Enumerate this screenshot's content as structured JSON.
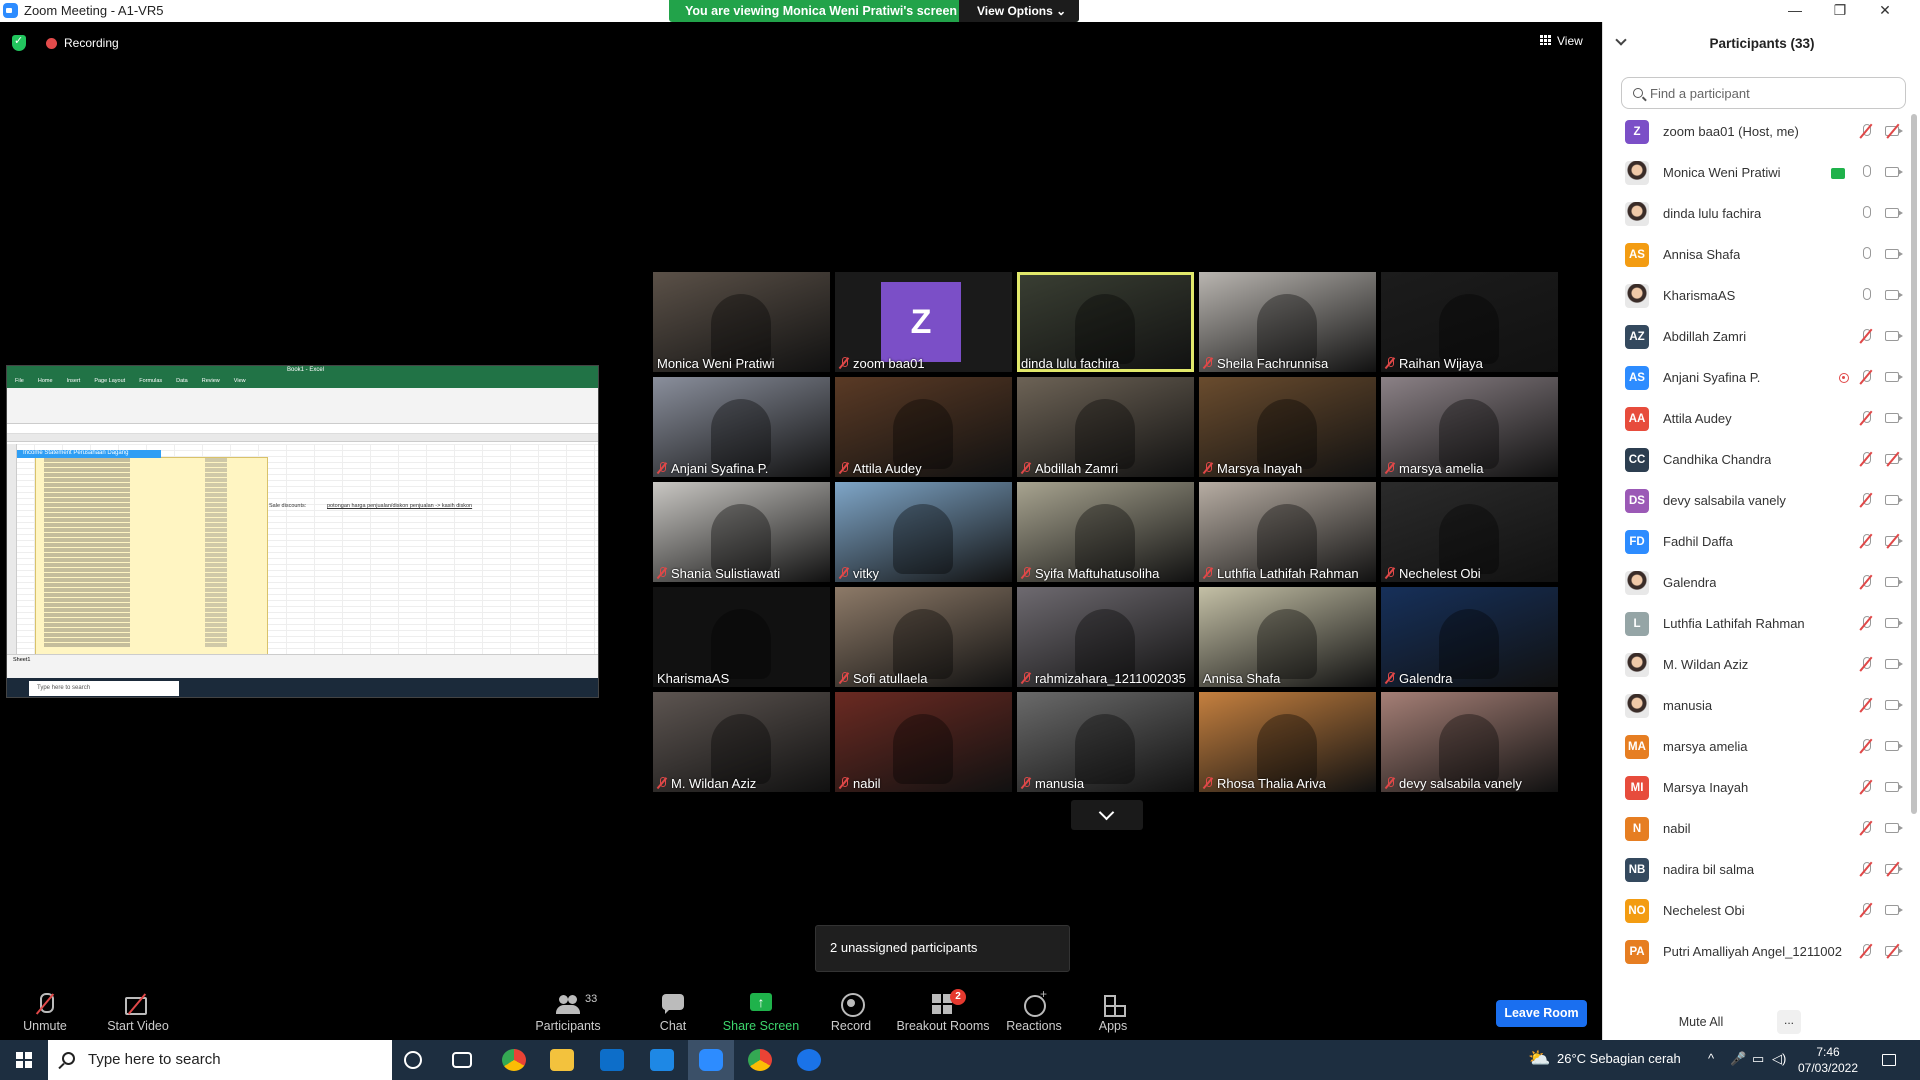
{
  "window": {
    "title": "Zoom Meeting - A1-VR5",
    "viewing_banner": "You are viewing Monica Weni Pratiwi's screen",
    "view_options": "View Options ⌄",
    "controls": {
      "minimize": "—",
      "restore": "❐",
      "close": "✕"
    }
  },
  "meeting_bar": {
    "recording": "Recording",
    "view": "View"
  },
  "shared_screen": {
    "title": "Book1 - Excel",
    "tabs": [
      "File",
      "Home",
      "Insert",
      "Page Layout",
      "Formulas",
      "Data",
      "Review",
      "View"
    ],
    "sheet_title": "Income Statement Perusahaan Dagang",
    "note_label": "Sale discounts:",
    "note_text": "potongan harga penjualan/diskon penjualan -> kasih diskon",
    "sheet_tab": "Sheet1",
    "taskbar_search": "Type here to search"
  },
  "video_tiles": [
    {
      "name": "Monica Weni Pratiwi",
      "muted": false,
      "bg": "#5b5148"
    },
    {
      "name": "zoom baa01",
      "muted": true,
      "bg": "#1a1a1a",
      "avatar": "Z"
    },
    {
      "name": "dinda lulu fachira",
      "muted": false,
      "bg": "#3a3f33",
      "active": true
    },
    {
      "name": "Sheila Fachrunnisa",
      "muted": true,
      "bg": "#b9b5b0"
    },
    {
      "name": "Raihan Wijaya",
      "muted": true,
      "bg": "#1c1c1c"
    },
    {
      "name": "Anjani Syafina P.",
      "muted": true,
      "bg": "#8a8f9c"
    },
    {
      "name": "Attila Audey",
      "muted": true,
      "bg": "#5a3a25"
    },
    {
      "name": "Abdillah Zamri",
      "muted": true,
      "bg": "#6d6356"
    },
    {
      "name": "Marsya Inayah",
      "muted": true,
      "bg": "#6a4c2e"
    },
    {
      "name": "marsya amelia",
      "muted": true,
      "bg": "#8b8186"
    },
    {
      "name": "Shania Sulistiawati",
      "muted": true,
      "bg": "#c9c7c3"
    },
    {
      "name": "vitky",
      "muted": true,
      "bg": "#7fa6c8"
    },
    {
      "name": "Syifa Maftuhatusoliha",
      "muted": true,
      "bg": "#a8a490"
    },
    {
      "name": "Luthfia Lathifah Rahman",
      "muted": true,
      "bg": "#b7ada3"
    },
    {
      "name": "Nechelest Obi",
      "muted": true,
      "bg": "#2b2b2b"
    },
    {
      "name": "KharismaAS",
      "muted": false,
      "bg": "#111111"
    },
    {
      "name": "Sofi atullaela",
      "muted": true,
      "bg": "#8d7a68"
    },
    {
      "name": "rahmizahara_1211002035",
      "muted": true,
      "bg": "#6e6a70"
    },
    {
      "name": "Annisa Shafa",
      "muted": false,
      "bg": "#c4c0a6"
    },
    {
      "name": "Galendra",
      "muted": true,
      "bg": "#16305a"
    },
    {
      "name": "M. Wildan Aziz",
      "muted": true,
      "bg": "#5d5551"
    },
    {
      "name": "nabil",
      "muted": true,
      "bg": "#6b2a22"
    },
    {
      "name": "manusia",
      "muted": true,
      "bg": "#6a6a6a"
    },
    {
      "name": "Rhosa Thalia Ariva",
      "muted": true,
      "bg": "#c5803f"
    },
    {
      "name": "devy salsabila vanely",
      "muted": true,
      "bg": "#a57f76"
    }
  ],
  "unassigned_text": "2 unassigned participants",
  "toolbar": {
    "unmute": "Unmute",
    "start_video": "Start Video",
    "participants": "Participants",
    "participants_count": "33",
    "chat": "Chat",
    "share_screen": "Share Screen",
    "record": "Record",
    "breakout_rooms": "Breakout Rooms",
    "breakout_badge": "2",
    "reactions": "Reactions",
    "apps": "Apps",
    "leave": "Leave Room"
  },
  "participants_panel": {
    "title": "Participants (33)",
    "search_placeholder": "Find a participant",
    "mute_all": "Mute All",
    "more": "...",
    "items": [
      {
        "name": "zoom baa01 (Host, me)",
        "initials": "Z",
        "color": "#7b4fc7",
        "mic_muted": true,
        "cam_off": true
      },
      {
        "name": "Monica Weni Pratiwi",
        "initials": "",
        "color": "#d9b8a0",
        "photo": true,
        "sharing": true,
        "mic_muted": false,
        "cam_off": false
      },
      {
        "name": "dinda lulu fachira",
        "initials": "",
        "color": "#c94b4b",
        "photo": true,
        "mic_muted": false,
        "cam_off": false
      },
      {
        "name": "Annisa Shafa",
        "initials": "AS",
        "color": "#f39c12",
        "mic_muted": false,
        "cam_off": false
      },
      {
        "name": "KharismaAS",
        "initials": "",
        "color": "#111111",
        "photo": true,
        "mic_muted": false,
        "cam_off": false
      },
      {
        "name": "Abdillah Zamri",
        "initials": "AZ",
        "color": "#34495e",
        "mic_muted": true,
        "cam_off": false
      },
      {
        "name": "Anjani Syafina P.",
        "initials": "AS",
        "color": "#2d8cff",
        "recording": true,
        "mic_muted": true,
        "cam_off": false
      },
      {
        "name": "Attila Audey",
        "initials": "AA",
        "color": "#e74c3c",
        "mic_muted": true,
        "cam_off": false
      },
      {
        "name": "Candhika Chandra",
        "initials": "CC",
        "color": "#2c3e50",
        "mic_muted": true,
        "cam_off": true
      },
      {
        "name": "devy salsabila vanely",
        "initials": "DS",
        "color": "#9b59b6",
        "mic_muted": true,
        "cam_off": false
      },
      {
        "name": "Fadhil Daffa",
        "initials": "FD",
        "color": "#2d8cff",
        "mic_muted": true,
        "cam_off": true
      },
      {
        "name": "Galendra",
        "initials": "",
        "color": "#111111",
        "photo": true,
        "mic_muted": true,
        "cam_off": false
      },
      {
        "name": "Luthfia Lathifah Rahman",
        "initials": "L",
        "color": "#95a5a6",
        "mic_muted": true,
        "cam_off": false
      },
      {
        "name": "M. Wildan Aziz",
        "initials": "",
        "color": "#5d4037",
        "photo": true,
        "mic_muted": true,
        "cam_off": false
      },
      {
        "name": "manusia",
        "initials": "",
        "color": "#8a7a6a",
        "photo": true,
        "mic_muted": true,
        "cam_off": false
      },
      {
        "name": "marsya amelia",
        "initials": "MA",
        "color": "#e67e22",
        "mic_muted": true,
        "cam_off": false
      },
      {
        "name": "Marsya Inayah",
        "initials": "MI",
        "color": "#e74c3c",
        "mic_muted": true,
        "cam_off": false
      },
      {
        "name": "nabil",
        "initials": "N",
        "color": "#e67e22",
        "mic_muted": true,
        "cam_off": false
      },
      {
        "name": "nadira bil salma",
        "initials": "NB",
        "color": "#34495e",
        "mic_muted": true,
        "cam_off": true
      },
      {
        "name": "Nechelest Obi",
        "initials": "NO",
        "color": "#f39c12",
        "mic_muted": true,
        "cam_off": false
      },
      {
        "name": "Putri Amalliyah Angel_1211002...",
        "initials": "PA",
        "color": "#e67e22",
        "mic_muted": true,
        "cam_off": true
      }
    ]
  },
  "taskbar": {
    "search": "Type here to search",
    "weather": "26°C  Sebagian cerah",
    "time": "7:46",
    "date": "07/03/2022"
  }
}
